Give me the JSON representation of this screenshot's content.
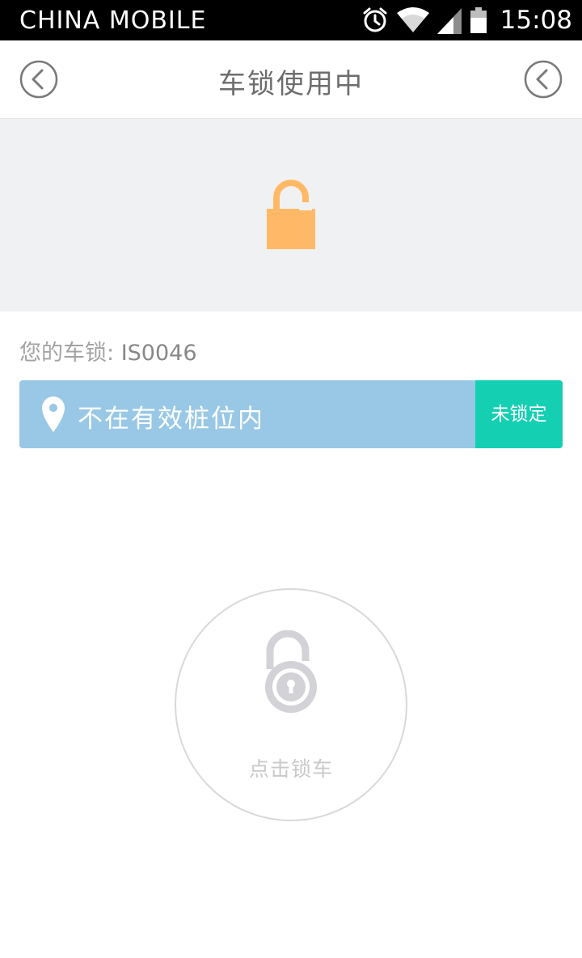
{
  "status_bar": {
    "carrier": "CHINA  MOBILE",
    "time": "15:08",
    "icons": [
      "alarm-icon",
      "wifi-icon",
      "signal-icon",
      "battery-icon"
    ]
  },
  "header": {
    "title": "车锁使用中",
    "left_button_icon": "back-circle-icon",
    "right_button_icon": "back-circle-icon"
  },
  "banner": {
    "icon": "unlocked-padlock-icon",
    "icon_color": "#ffb966"
  },
  "lock_info": {
    "label": "您的车锁:",
    "lock_id": "IS0046"
  },
  "location": {
    "icon": "location-pin-icon",
    "text": "不在有效桩位内",
    "state": "未锁定",
    "bar_color": "#99c8e6",
    "state_color": "#14cfb2"
  },
  "lock_action": {
    "icon": "unlocked-padlock-icon",
    "label": "点击锁车"
  }
}
